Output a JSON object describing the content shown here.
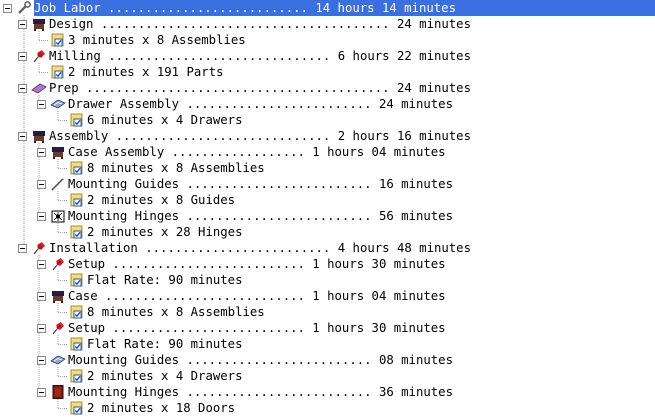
{
  "tree": {
    "rows": [
      {
        "id": "r0",
        "depth": 0,
        "kind": "root",
        "text": "Job Labor ........................... 14 hours 14 minutes",
        "icon": "wrench-icon",
        "expanded": true
      },
      {
        "id": "r1",
        "depth": 1,
        "kind": "group",
        "text": "Design ....................................... 24 minutes",
        "icon": "drafting-table-icon",
        "expanded": true
      },
      {
        "id": "r2",
        "depth": 2,
        "kind": "leaf",
        "text": "3 minutes x 8 Assemblies",
        "icon": "note-check-icon"
      },
      {
        "id": "r3",
        "depth": 1,
        "kind": "group",
        "text": "Milling .............................. 6 hours 22 minutes",
        "icon": "red-pushpin-icon",
        "expanded": true
      },
      {
        "id": "r4",
        "depth": 2,
        "kind": "leaf",
        "text": "2 minutes x 191 Parts",
        "icon": "note-check-icon"
      },
      {
        "id": "r5",
        "depth": 1,
        "kind": "group",
        "text": "Prep ......................................... 24 minutes",
        "icon": "panel-icon",
        "expanded": true
      },
      {
        "id": "r6",
        "depth": 2,
        "kind": "group",
        "text": "Drawer Assembly ......................... 24 minutes",
        "icon": "drawer-icon",
        "expanded": true
      },
      {
        "id": "r7",
        "depth": 3,
        "kind": "leaf",
        "text": "6 minutes x 4 Drawers",
        "icon": "note-check-icon"
      },
      {
        "id": "r8",
        "depth": 1,
        "kind": "group",
        "text": "Assembly ............................. 2 hours 16 minutes",
        "icon": "drafting-table-icon",
        "expanded": true
      },
      {
        "id": "r9",
        "depth": 2,
        "kind": "group",
        "text": "Case Assembly .................. 1 hours 04 minutes",
        "icon": "drafting-table-icon",
        "expanded": true
      },
      {
        "id": "r10",
        "depth": 3,
        "kind": "leaf",
        "text": "8 minutes x 8 Assemblies",
        "icon": "note-check-icon"
      },
      {
        "id": "r11",
        "depth": 2,
        "kind": "group",
        "text": "Mounting Guides ......................... 16 minutes",
        "icon": "guide-rail-icon",
        "expanded": true
      },
      {
        "id": "r12",
        "depth": 3,
        "kind": "leaf",
        "text": "2 minutes x 8 Guides",
        "icon": "note-check-icon"
      },
      {
        "id": "r13",
        "depth": 2,
        "kind": "group",
        "text": "Mounting Hinges ......................... 56 minutes",
        "icon": "hinge-icon",
        "expanded": true
      },
      {
        "id": "r14",
        "depth": 3,
        "kind": "leaf",
        "text": "2 minutes x 28 Hinges",
        "icon": "note-check-icon"
      },
      {
        "id": "r15",
        "depth": 1,
        "kind": "group",
        "text": "Installation ......................... 4 hours 48 minutes",
        "icon": "red-pushpin-icon",
        "expanded": true
      },
      {
        "id": "r16",
        "depth": 2,
        "kind": "group",
        "text": "Setup .......................... 1 hours 30 minutes",
        "icon": "red-pushpin-icon",
        "expanded": true
      },
      {
        "id": "r17",
        "depth": 3,
        "kind": "leaf",
        "text": "Flat Rate: 90 minutes",
        "icon": "note-check-icon"
      },
      {
        "id": "r18",
        "depth": 2,
        "kind": "group",
        "text": "Case ........................... 1 hours 04 minutes",
        "icon": "drafting-table-icon",
        "expanded": true
      },
      {
        "id": "r19",
        "depth": 3,
        "kind": "leaf",
        "text": "8 minutes x 8 Assemblies",
        "icon": "note-check-icon"
      },
      {
        "id": "r20",
        "depth": 2,
        "kind": "group",
        "text": "Setup .......................... 1 hours 30 minutes",
        "icon": "red-pushpin-icon",
        "expanded": true
      },
      {
        "id": "r21",
        "depth": 3,
        "kind": "leaf",
        "text": "Flat Rate: 90 minutes",
        "icon": "note-check-icon"
      },
      {
        "id": "r22",
        "depth": 2,
        "kind": "group",
        "text": "Mounting Guides ......................... 08 minutes",
        "icon": "drawer-icon",
        "expanded": true
      },
      {
        "id": "r23",
        "depth": 3,
        "kind": "leaf",
        "text": "2 minutes x 4 Drawers",
        "icon": "note-check-icon"
      },
      {
        "id": "r24",
        "depth": 2,
        "kind": "group",
        "text": "Mounting Hinges ......................... 36 minutes",
        "icon": "door-icon",
        "expanded": true
      },
      {
        "id": "r25",
        "depth": 3,
        "kind": "leaf",
        "text": "2 minutes x 18 Doors",
        "icon": "note-check-icon"
      }
    ],
    "selected_index": 0,
    "colors": {
      "selection": "#3a6fe0",
      "selection_text": "#ffffff",
      "tree_line": "#a0a0a0"
    }
  }
}
